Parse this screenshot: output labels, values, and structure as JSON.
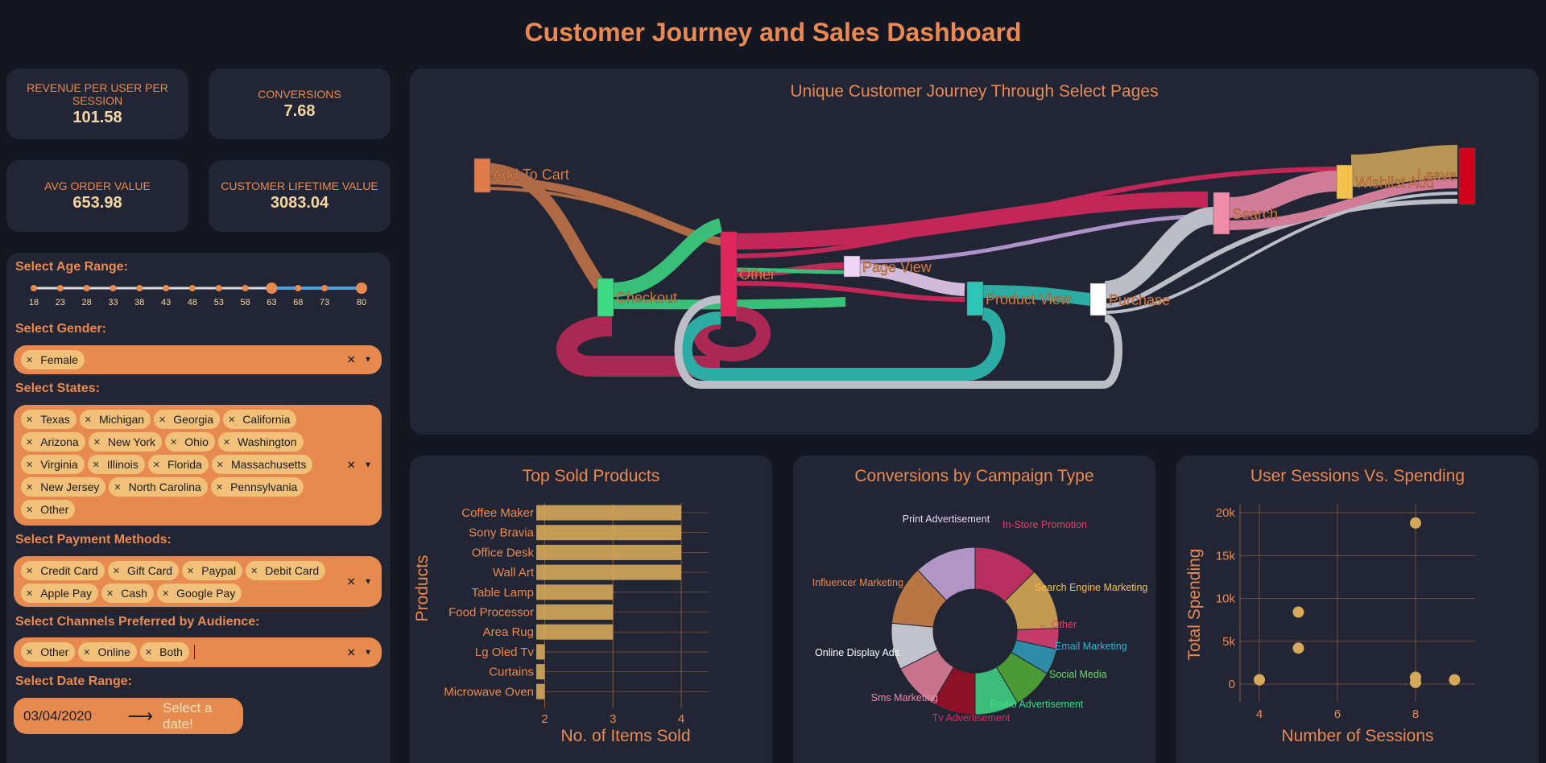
{
  "page": {
    "title": "Customer Journey and Sales Dashboard"
  },
  "kpis": [
    {
      "label": "REVENUE PER USER PER SESSION",
      "value": "101.58"
    },
    {
      "label": "CONVERSIONS",
      "value": "7.68"
    },
    {
      "label": "AVG ORDER VALUE",
      "value": "653.98"
    },
    {
      "label": "CUSTOMER LIFETIME VALUE",
      "value": "3083.04"
    }
  ],
  "filters": {
    "age": {
      "label": "Select Age Range:",
      "ticks": [
        "18",
        "23",
        "28",
        "33",
        "38",
        "43",
        "48",
        "53",
        "58",
        "63",
        "68",
        "73",
        "80"
      ],
      "min": 18,
      "max": 80,
      "selected": [
        63,
        80
      ]
    },
    "gender": {
      "label": "Select Gender:",
      "chips": [
        "Female"
      ]
    },
    "states": {
      "label": "Select States:",
      "chips": [
        "Texas",
        "Michigan",
        "Georgia",
        "California",
        "Arizona",
        "New York",
        "Ohio",
        "Washington",
        "Virginia",
        "Illinois",
        "Florida",
        "Massachusetts",
        "New Jersey",
        "North Carolina",
        "Pennsylvania",
        "Other"
      ]
    },
    "payment": {
      "label": "Select Payment Methods:",
      "chips": [
        "Credit Card",
        "Gift Card",
        "Paypal",
        "Debit Card",
        "Apple Pay",
        "Cash",
        "Google Pay"
      ]
    },
    "channels": {
      "label": "Select Channels Preferred by Audience:",
      "chips": [
        "Other",
        "Online",
        "Both"
      ]
    },
    "date": {
      "label": "Select Date Range:",
      "start": "03/04/2020",
      "end_placeholder": "Select a date!"
    }
  },
  "sankey": {
    "title": "Unique Customer Journey Through Select Pages",
    "nodes": [
      {
        "name": "Add To Cart",
        "color": "#e07b4a"
      },
      {
        "name": "Checkout",
        "color": "#3ddc84"
      },
      {
        "name": "Other",
        "color": "#e0285f"
      },
      {
        "name": "Page View",
        "color": "#f0d4f7"
      },
      {
        "name": "Product View",
        "color": "#2ec4b6"
      },
      {
        "name": "Purchase",
        "color": "#ffffff"
      },
      {
        "name": "Search",
        "color": "#f08caa"
      },
      {
        "name": "Wishlist Add",
        "color": "#f2c14e"
      },
      {
        "name": "Leave",
        "color": "#d0021b"
      }
    ]
  },
  "top_products": {
    "title": "Top Sold Products",
    "xlabel": "No. of Items Sold",
    "ylabel": "Products"
  },
  "campaign": {
    "title": "Conversions by Campaign Type"
  },
  "sessions": {
    "title": "User Sessions Vs. Spending",
    "xlabel": "Number of Sessions",
    "ylabel": "Total Spending"
  },
  "chart_data": [
    {
      "type": "bar",
      "orientation": "horizontal",
      "title": "Top Sold Products",
      "xlabel": "No. of Items Sold",
      "ylabel": "Products",
      "categories": [
        "Coffee Maker",
        "Sony Bravia",
        "Office Desk",
        "Wall Art",
        "Table Lamp",
        "Food Processor",
        "Area Rug",
        "Lg Oled Tv",
        "Curtains",
        "Microwave Oven"
      ],
      "values": [
        4,
        4,
        4,
        4,
        3,
        3,
        3,
        2,
        2,
        2
      ],
      "xticks": [
        "2",
        "3",
        "4"
      ],
      "color": "#d4a95b"
    },
    {
      "type": "pie",
      "hole": true,
      "title": "Conversions by Campaign Type",
      "labels": [
        "In-Store Promotion",
        "Search Engine Marketing",
        "Other",
        "Email Marketing",
        "Social Media",
        "Radio Advertisement",
        "Tv Advertisement",
        "Sms Marketing",
        "Online Display Ads",
        "Influencer Marketing",
        "Print Advertisement"
      ],
      "values": [
        12.5,
        12,
        4,
        5,
        8,
        8.5,
        8.5,
        9,
        9,
        11.5,
        12
      ],
      "colors": [
        "#b8305f",
        "#c49a52",
        "#c43d6a",
        "#2f8ca6",
        "#4a9b36",
        "#3cbd7a",
        "#8b1126",
        "#c8738c",
        "#c2c2cc",
        "#b87645",
        "#b394c6"
      ],
      "label_colors": [
        "#e0406a",
        "#f2c14e",
        "#e0406a",
        "#2fb4d6",
        "#6ed66a",
        "#3ddc84",
        "#e0285f",
        "#f08caa",
        "#ffffff",
        "#ea8a52",
        "#e8d4f7"
      ]
    },
    {
      "type": "scatter",
      "title": "User Sessions Vs. Spending",
      "xlabel": "Number of Sessions",
      "ylabel": "Total Spending",
      "x": [
        4,
        5,
        5,
        8,
        8,
        8,
        9
      ],
      "y": [
        500,
        8400,
        4200,
        18800,
        800,
        200,
        500
      ],
      "xticks": [
        "4",
        "6",
        "8"
      ],
      "yticks": [
        "0",
        "5k",
        "10k",
        "15k",
        "20k"
      ],
      "color": "#d4a95b"
    }
  ]
}
